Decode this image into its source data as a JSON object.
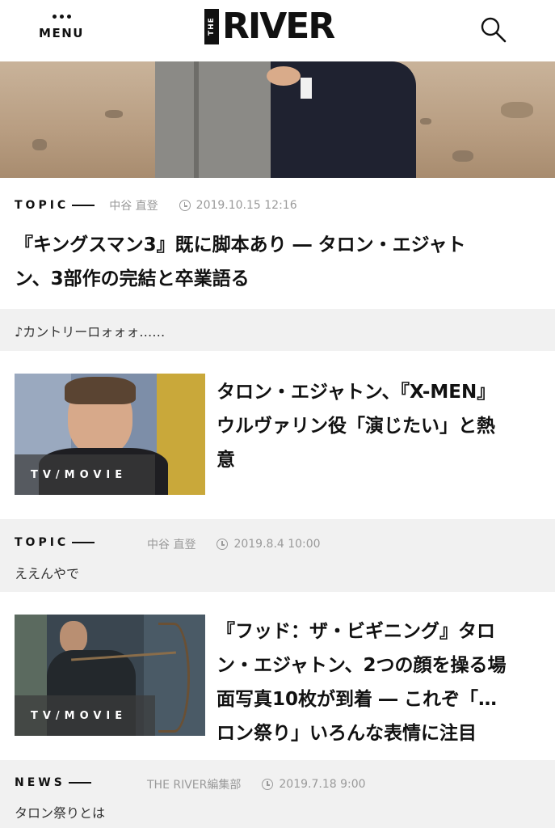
{
  "header": {
    "menu_label": "MENU",
    "logo_the": "THE",
    "logo_main": "RIVER"
  },
  "hero_article": {
    "category": "TOPIC",
    "author": "中谷 直登",
    "date": "2019.10.15 12:16",
    "title_line1": "『キングスマン3』既に脚本あり ― タロン・エジャト",
    "title_line2": "ン、3部作の完結と卒業語る"
  },
  "comment1": "♪カントリーロォォォ……",
  "article2": {
    "category_badge": "TV/MOVIE",
    "title_line1": "タロン・エジャトン、『X-MEN』",
    "title_line2": "ウルヴァリン役「演じたい」と熱",
    "title_line3": "意",
    "meta_category": "TOPIC",
    "author": "中谷 直登",
    "date": "2019.8.4 10:00",
    "comment": "ええんやで"
  },
  "article3": {
    "category_badge": "TV/MOVIE",
    "title_line1": "『フッド：ザ・ビギニング』タロ",
    "title_line2": "ン・エジャトン、2つの顔を操る場",
    "title_line3": "面写真10枚が到着 ― これぞ「…",
    "title_line4": "ロン祭り」いろんな表情に注目",
    "meta_category": "NEWS",
    "author": "THE RIVER編集部",
    "date": "2019.7.18 9:00",
    "comment": "タロン祭りとは"
  },
  "colors": {
    "text": "#111111",
    "muted": "#9a9a9a",
    "panel": "#f1f1f1"
  }
}
